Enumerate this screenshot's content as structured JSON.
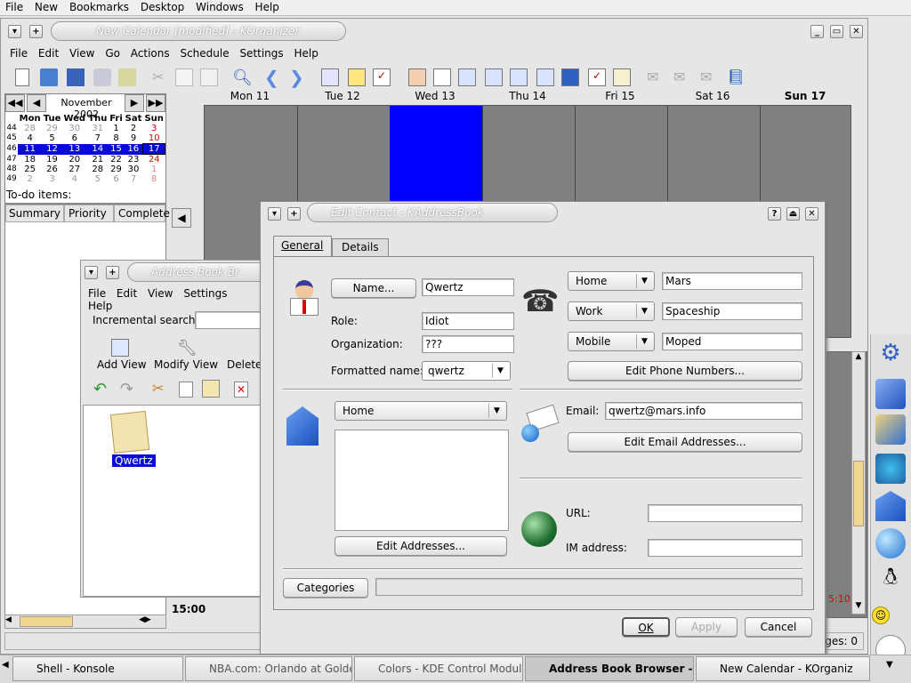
{
  "top_menu": {
    "file": "File",
    "new": "New",
    "bookmarks": "Bookmarks",
    "desktop": "Desktop",
    "windows": "Windows",
    "help": "Help"
  },
  "korg": {
    "title": "New Calendar [modified] - KOrganizer",
    "menu": [
      "File",
      "Edit",
      "View",
      "Go",
      "Actions",
      "Schedule",
      "Settings",
      "Help"
    ],
    "month": "November 2002",
    "weekdays": [
      "Mon",
      "Tue",
      "Wed",
      "Thu",
      "Fri",
      "Sat",
      "Sun"
    ],
    "weeks": [
      {
        "num": "44",
        "days": [
          "28",
          "29",
          "30",
          "31",
          "1",
          "2",
          "3"
        ]
      },
      {
        "num": "45",
        "days": [
          "4",
          "5",
          "6",
          "7",
          "8",
          "9",
          "10"
        ]
      },
      {
        "num": "46",
        "days": [
          "11",
          "12",
          "13",
          "14",
          "15",
          "16",
          "17"
        ]
      },
      {
        "num": "47",
        "days": [
          "18",
          "19",
          "20",
          "21",
          "22",
          "23",
          "24"
        ]
      },
      {
        "num": "48",
        "days": [
          "25",
          "26",
          "27",
          "28",
          "29",
          "30",
          "1"
        ]
      },
      {
        "num": "49",
        "days": [
          "2",
          "3",
          "4",
          "5",
          "6",
          "7",
          "8"
        ]
      }
    ],
    "todo_label": "To-do items:",
    "todo_cols": [
      "Summary",
      "Priority",
      "Complete"
    ],
    "day_headers": [
      "Mon 11",
      "Tue 12",
      "Wed 13",
      "Thu 14",
      "Fri 15",
      "Sat 16",
      "Sun 17"
    ],
    "time": "15:00",
    "status": "ages: 0",
    "red_time": "5:10"
  },
  "addrbook": {
    "title": "Address Book Br",
    "menu": [
      "File",
      "Edit",
      "View",
      "Settings",
      "Help"
    ],
    "search_label": "Incremental search:",
    "tools": [
      "Add View",
      "Modify View",
      "Delete"
    ],
    "contact": "Qwertz"
  },
  "dialog": {
    "title": "Edit Contact - KAddressBook",
    "tabs": [
      "General",
      "Details"
    ],
    "name_button": "Name...",
    "name_value": "Qwertz",
    "role_label": "Role:",
    "role_value": "Idiot",
    "org_label": "Organization:",
    "org_value": "???",
    "formatted_label": "Formatted name:",
    "formatted_value": "qwertz",
    "phones": [
      {
        "type": "Home",
        "value": "Mars"
      },
      {
        "type": "Work",
        "value": "Spaceship"
      },
      {
        "type": "Mobile",
        "value": "Moped"
      }
    ],
    "edit_phones": "Edit Phone Numbers...",
    "address_type": "Home",
    "edit_addresses": "Edit Addresses...",
    "email_label": "Email:",
    "email_value": "qwertz@mars.info",
    "edit_emails": "Edit Email Addresses...",
    "url_label": "URL:",
    "url_value": "",
    "im_label": "IM address:",
    "im_value": "",
    "categories": "Categories",
    "ok": "OK",
    "apply": "Apply",
    "cancel": "Cancel"
  },
  "taskbar": [
    {
      "label": "Shell - Konsole"
    },
    {
      "label": "NBA.com: Orlando at Golden"
    },
    {
      "label": "Colors - KDE Control Module"
    },
    {
      "label": "Address Book Browser - KA"
    },
    {
      "label": "New Calendar - KOrganiz"
    }
  ],
  "colors": {
    "highlight": "#0a0ad8",
    "selected_day": "#0000ff",
    "calendar_bg": "#808080"
  }
}
